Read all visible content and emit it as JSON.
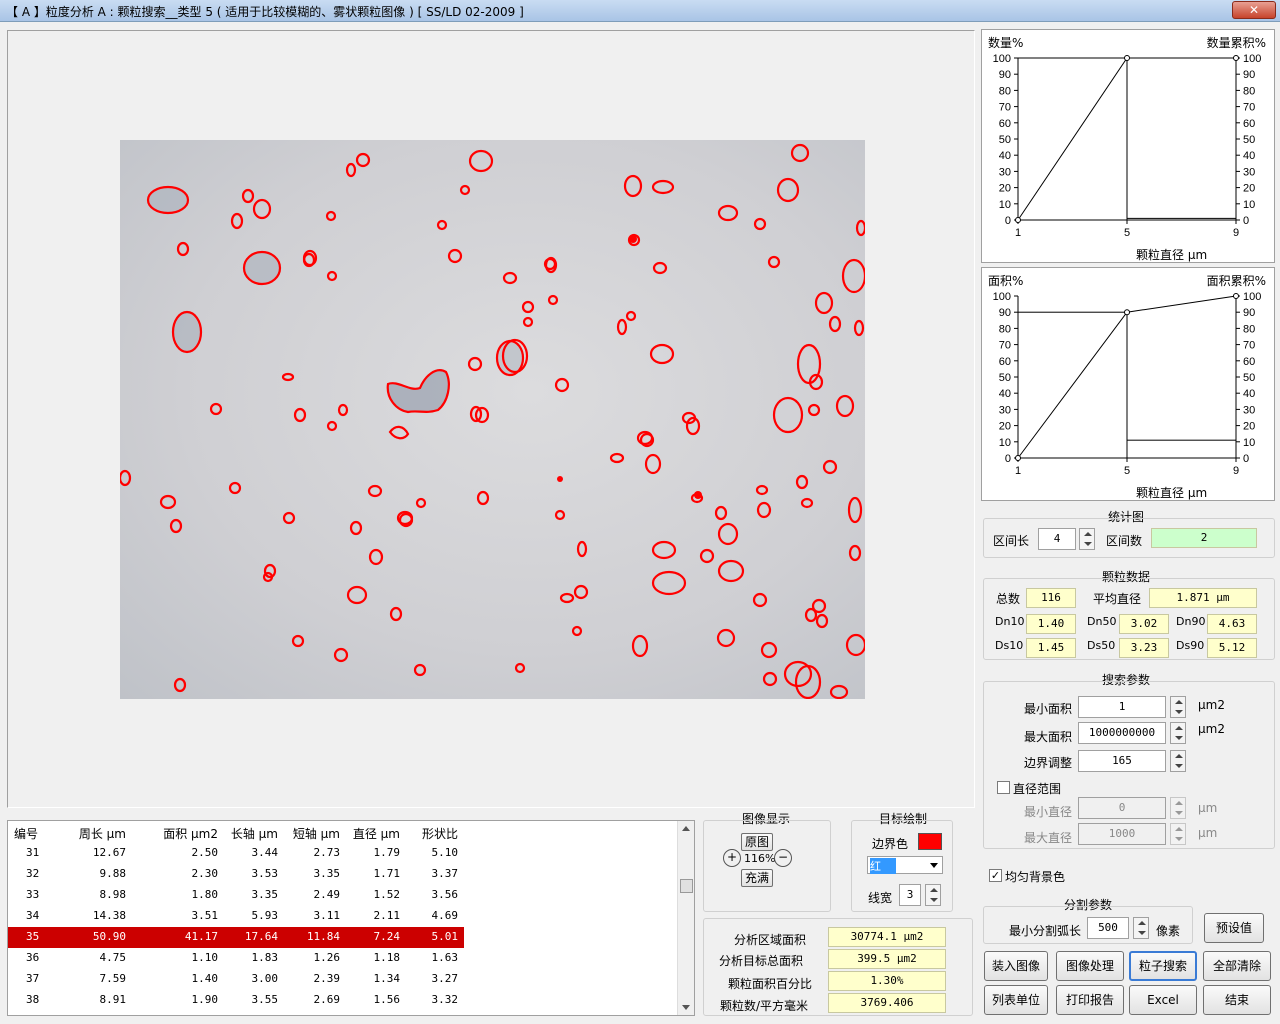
{
  "window": {
    "title": "【 A 】粒度分析 A : 颗粒搜索__类型 5 ( 适用于比较模糊的、雾状颗粒图像 ) [ SS/LD 02-2009 ]",
    "close_label": "✕"
  },
  "charts": {
    "count": {
      "ylabel_left": "数量%",
      "ylabel_right": "数量累积%",
      "xlabel": "颗粒直径 μm",
      "x_ticks": [
        "1",
        "5",
        "9"
      ],
      "y_ticks": [
        "0",
        "10",
        "20",
        "30",
        "40",
        "50",
        "60",
        "70",
        "80",
        "90",
        "100"
      ]
    },
    "area": {
      "ylabel_left": "面积%",
      "ylabel_right": "面积累积%",
      "xlabel": "颗粒直径 μm",
      "x_ticks": [
        "1",
        "5",
        "9"
      ],
      "y_ticks": [
        "0",
        "10",
        "20",
        "30",
        "40",
        "50",
        "60",
        "70",
        "80",
        "90",
        "100"
      ]
    }
  },
  "chart_data": [
    {
      "type": "bar",
      "title": "",
      "xlabel": "颗粒直径 μm",
      "ylabel": "数量%",
      "y2label": "数量累积%",
      "x_bins": [
        [
          1,
          5
        ],
        [
          5,
          9
        ]
      ],
      "values": [
        100,
        1
      ],
      "cumulative": [
        [
          1,
          0
        ],
        [
          5,
          100
        ],
        [
          9,
          100
        ]
      ],
      "xlim": [
        1,
        9
      ],
      "ylim": [
        0,
        100
      ],
      "grid": false
    },
    {
      "type": "bar",
      "title": "",
      "xlabel": "颗粒直径 μm",
      "ylabel": "面积%",
      "y2label": "面积累积%",
      "x_bins": [
        [
          1,
          5
        ],
        [
          5,
          9
        ]
      ],
      "values": [
        90,
        11
      ],
      "cumulative": [
        [
          1,
          0
        ],
        [
          5,
          90
        ],
        [
          9,
          100
        ]
      ],
      "xlim": [
        1,
        9
      ],
      "ylim": [
        0,
        100
      ],
      "grid": false
    }
  ],
  "stats": {
    "title": "统计图",
    "interval_len_label": "区间长",
    "interval_len": "4",
    "interval_count_label": "区间数",
    "interval_count": "2"
  },
  "particle": {
    "title": "颗粒数据",
    "total_label": "总数",
    "total": "116",
    "mean_label": "平均直径",
    "mean": "1.871 μm",
    "dn10_label": "Dn10",
    "dn10": "1.40",
    "dn50_label": "Dn50",
    "dn50": "3.02",
    "dn90_label": "Dn90",
    "dn90": "4.63",
    "ds10_label": "Ds10",
    "ds10": "1.45",
    "ds50_label": "Ds50",
    "ds50": "3.23",
    "ds90_label": "Ds90",
    "ds90": "5.12"
  },
  "search": {
    "title": "搜索参数",
    "min_area_label": "最小面积",
    "min_area": "1",
    "min_area_unit": "μm2",
    "max_area_label": "最大面积",
    "max_area": "1000000000",
    "max_area_unit": "μm2",
    "edge_label": "边界调整",
    "edge": "165",
    "diam_range_label": "直径范围",
    "diam_range_checked": false,
    "min_diam_label": "最小直径",
    "min_diam": "0",
    "min_diam_unit": "μm",
    "max_diam_label": "最大直径",
    "max_diam": "1000",
    "max_diam_unit": "μm"
  },
  "uniform_bg": {
    "label": "均匀背景色",
    "checked": true
  },
  "segment": {
    "title": "分割参数",
    "min_arc_label": "最小分割弧长",
    "min_arc": "500",
    "unit": "像素",
    "preset_label": "预设值"
  },
  "buttons": {
    "load": "装入图像",
    "process": "图像处理",
    "search": "粒子搜索",
    "clear": "全部清除",
    "list_unit": "列表单位",
    "print": "打印报告",
    "excel": "Excel",
    "end": "结束"
  },
  "image_display": {
    "title": "图像显示",
    "original": "原图",
    "zoom": "116%",
    "fill": "充满"
  },
  "target_draw": {
    "title": "目标绘制",
    "border_color_label": "边界色",
    "border_color": "#ff0000",
    "color_select": "红",
    "line_width_label": "线宽",
    "line_width": "3"
  },
  "analysis": {
    "area_label": "分析区域面积",
    "area": "30774.1 μm2",
    "target_label": "分析目标总面积",
    "target": "399.5 μm2",
    "pct_label": "颗粒面积百分比",
    "pct": "1.30%",
    "density_label": "颗粒数/平方毫米",
    "density": "3769.406"
  },
  "table": {
    "headers": [
      "编号",
      "周长 μm",
      "面积 μm2",
      "长轴 μm",
      "短轴 μm",
      "直径 μm",
      "形状比"
    ],
    "rows": [
      [
        "31",
        "12.67",
        "2.50",
        "3.44",
        "2.73",
        "1.79",
        "5.10"
      ],
      [
        "32",
        "9.88",
        "2.30",
        "3.53",
        "3.35",
        "1.71",
        "3.37"
      ],
      [
        "33",
        "8.98",
        "1.80",
        "3.35",
        "2.49",
        "1.52",
        "3.56"
      ],
      [
        "34",
        "14.38",
        "3.51",
        "5.93",
        "3.11",
        "2.11",
        "4.69"
      ],
      [
        "35",
        "50.90",
        "41.17",
        "17.64",
        "11.84",
        "7.24",
        "5.01"
      ],
      [
        "36",
        "4.75",
        "1.10",
        "1.83",
        "1.26",
        "1.18",
        "1.63"
      ],
      [
        "37",
        "7.59",
        "1.40",
        "3.00",
        "2.39",
        "1.34",
        "3.27"
      ],
      [
        "38",
        "8.91",
        "1.90",
        "3.55",
        "2.69",
        "1.56",
        "3.32"
      ]
    ],
    "selected_row": 4
  },
  "colors": {
    "accent": "#cc0000",
    "value_bg": "#ffffcc",
    "green_bg": "#ccffcc",
    "particle_outline": "#ff0000"
  }
}
